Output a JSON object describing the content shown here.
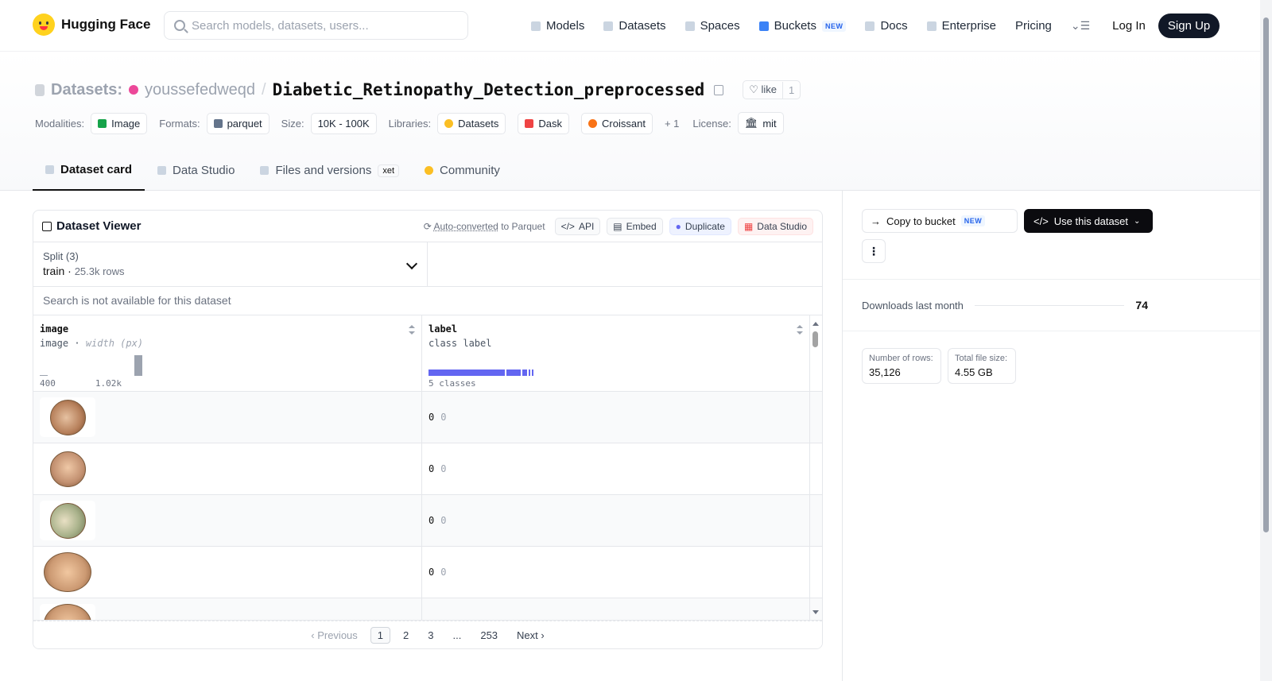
{
  "nav": {
    "brand": "Hugging Face",
    "search_placeholder": "Search models, datasets, users...",
    "links": [
      "Models",
      "Datasets",
      "Spaces",
      "Buckets",
      "Docs",
      "Enterprise",
      "Pricing"
    ],
    "new_badge": "NEW",
    "login": "Log In",
    "signup": "Sign Up"
  },
  "header": {
    "section": "Datasets:",
    "owner": "youssefedweqd",
    "separator": "/",
    "dataset_name": "Diabetic_Retinopathy_Detection_preprocessed",
    "like_label": "like",
    "like_count": "1",
    "tags": {
      "modalities_label": "Modalities:",
      "modality": "Image",
      "formats_label": "Formats:",
      "format": "parquet",
      "size_label": "Size:",
      "size": "10K - 100K",
      "libraries_label": "Libraries:",
      "libraries": [
        "Datasets",
        "Dask",
        "Croissant"
      ],
      "libraries_more": "+ 1",
      "license_label": "License:",
      "license": "mit"
    },
    "tabs": [
      "Dataset card",
      "Data Studio",
      "Files and versions",
      "Community"
    ],
    "xet_badge": "xet"
  },
  "viewer": {
    "title": "Dataset Viewer",
    "auto_converted_link": "Auto-converted",
    "auto_converted_suffix": " to Parquet",
    "api": "API",
    "embed": "Embed",
    "duplicate": "Duplicate",
    "data_studio": "Data Studio",
    "split_label": "Split (3)",
    "split_value": "train",
    "split_rows": "25.3k rows",
    "search_msg": "Search is not available for this dataset",
    "col1": {
      "name": "image",
      "type": "image",
      "sep": " · ",
      "subtype": "width (px)",
      "hist_min": "400",
      "hist_max": "1.02k"
    },
    "col2": {
      "name": "label",
      "type": "class label",
      "classes": "5 classes"
    },
    "rows": [
      {
        "label": "0",
        "label_class": "0"
      },
      {
        "label": "0",
        "label_class": "0"
      },
      {
        "label": "0",
        "label_class": "0"
      },
      {
        "label": "0",
        "label_class": "0"
      }
    ],
    "pager": {
      "prev": "‹ Previous",
      "pages": [
        "1",
        "2",
        "3",
        "...",
        "253"
      ],
      "next": "Next ›"
    }
  },
  "sidebar": {
    "copy_bucket": "Copy to bucket",
    "new_badge": "NEW",
    "use_dataset": "Use this dataset",
    "more": "⋮",
    "downloads_label": "Downloads last month",
    "downloads_value": "74",
    "rows_label": "Number of rows:",
    "rows_value": "35,126",
    "size_label": "Total file size:",
    "size_value": "4.55 GB"
  }
}
